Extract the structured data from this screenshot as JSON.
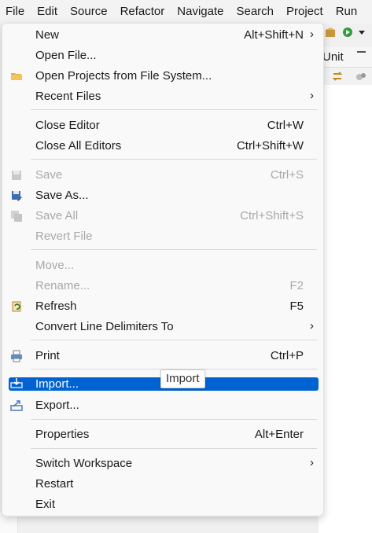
{
  "menubar": [
    "File",
    "Edit",
    "Source",
    "Refactor",
    "Navigate",
    "Search",
    "Project",
    "Run"
  ],
  "view_tab_label": "Unit",
  "menu": {
    "new": {
      "label": "New",
      "accel": "Alt+Shift+N"
    },
    "open_file": {
      "label": "Open File..."
    },
    "open_projects": {
      "label": "Open Projects from File System..."
    },
    "recent_files": {
      "label": "Recent Files"
    },
    "close_editor": {
      "label": "Close Editor",
      "accel": "Ctrl+W"
    },
    "close_all": {
      "label": "Close All Editors",
      "accel": "Ctrl+Shift+W"
    },
    "save": {
      "label": "Save",
      "accel": "Ctrl+S"
    },
    "save_as": {
      "label": "Save As..."
    },
    "save_all": {
      "label": "Save All",
      "accel": "Ctrl+Shift+S"
    },
    "revert": {
      "label": "Revert File"
    },
    "move": {
      "label": "Move..."
    },
    "rename": {
      "label": "Rename...",
      "accel": "F2"
    },
    "refresh": {
      "label": "Refresh",
      "accel": "F5"
    },
    "convert": {
      "label": "Convert Line Delimiters To"
    },
    "print": {
      "label": "Print",
      "accel": "Ctrl+P"
    },
    "import": {
      "label": "Import..."
    },
    "export": {
      "label": "Export..."
    },
    "properties": {
      "label": "Properties",
      "accel": "Alt+Enter"
    },
    "switch_ws": {
      "label": "Switch Workspace"
    },
    "restart": {
      "label": "Restart"
    },
    "exit": {
      "label": "Exit"
    },
    "submenu_arrow": "›"
  },
  "tooltip": "Import",
  "colors": {
    "selection": "#0063d1",
    "disabled_text": "#a8a8a8"
  },
  "icons": {
    "open_projects": "folder-icon",
    "save": "save-disk-icon",
    "save_as": "save-as-icon",
    "save_all": "save-all-icon",
    "refresh": "refresh-icon",
    "print": "printer-icon",
    "import": "import-icon",
    "export": "export-icon"
  }
}
